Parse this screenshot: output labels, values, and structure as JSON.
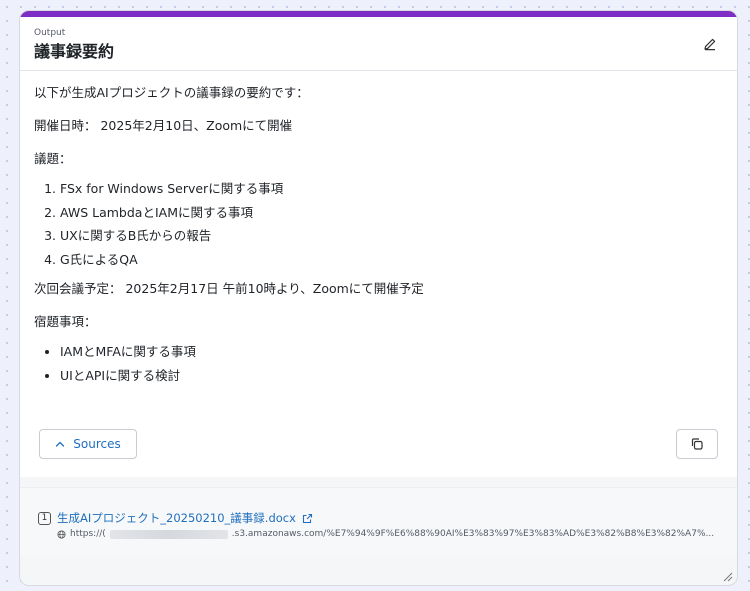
{
  "header": {
    "label": "Output",
    "title": "議事録要約"
  },
  "content": {
    "intro": "以下が生成AIプロジェクトの議事録の要約です：",
    "meeting_date": "開催日時： 2025年2月10日、Zoomにて開催",
    "agenda_heading": "議題：",
    "agenda": [
      "FSx for Windows Serverに関する事項",
      "AWS LambdaとIAMに関する事項",
      "UXに関するB氏からの報告",
      "G氏によるQA"
    ],
    "next_meeting": "次回会議予定： 2025年2月17日 午前10時より、Zoomにて開催予定",
    "homework_heading": "宿題事項：",
    "homework": [
      "IAMとMFAに関する事項",
      "UIとAPIに関する検討"
    ]
  },
  "actions": {
    "sources_label": "Sources"
  },
  "sources": [
    {
      "index": "1",
      "title": "生成AIプロジェクト_20250210_議事録.docx",
      "url_prefix": "https://(",
      "url_suffix": ".s3.amazonaws.com/%E7%94%9F%E6%88%90AI%E3%83%97%E3%83%AD%E3%82%B8%E3%82%A7%..."
    }
  ],
  "colors": {
    "accent_bar": "#7d2ec5",
    "link": "#1f6fbf"
  }
}
